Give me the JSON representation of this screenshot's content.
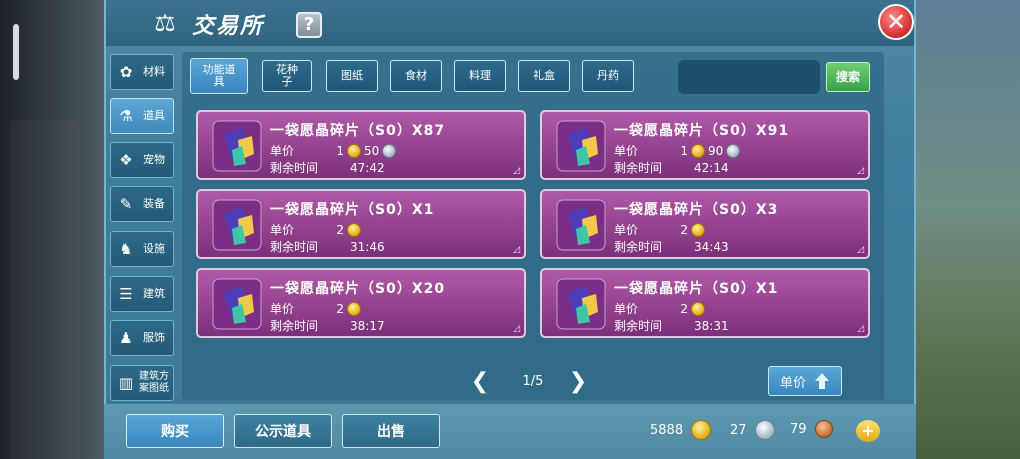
{
  "window": {
    "title": "交易所",
    "help_label": "?",
    "close_label": "✕"
  },
  "sidebar": {
    "items": [
      {
        "label": "材料",
        "icon": "materials-icon",
        "active": false
      },
      {
        "label": "道具",
        "icon": "flask-icon",
        "active": true
      },
      {
        "label": "宠物",
        "icon": "paw-icon",
        "active": false
      },
      {
        "label": "装备",
        "icon": "sword-icon",
        "active": false
      },
      {
        "label": "设施",
        "icon": "horse-icon",
        "active": false
      },
      {
        "label": "建筑",
        "icon": "building-icon",
        "active": false
      },
      {
        "label": "服饰",
        "icon": "clothing-icon",
        "active": false
      },
      {
        "label": "建筑方案图纸",
        "icon": "blueprint-icon",
        "active": false
      }
    ]
  },
  "tabs": [
    {
      "label": "功能道具",
      "active": true
    },
    {
      "label": "花种子",
      "active": false
    },
    {
      "label": "图纸",
      "active": false
    },
    {
      "label": "食材",
      "active": false
    },
    {
      "label": "料理",
      "active": false
    },
    {
      "label": "礼盒",
      "active": false
    },
    {
      "label": "丹药",
      "active": false
    }
  ],
  "search": {
    "placeholder": "",
    "button_label": "搜索"
  },
  "listing_labels": {
    "unit_price": "单价",
    "time_left": "剩余时间"
  },
  "listings": [
    {
      "name": "一袋愿晶碎片（S0）X87",
      "gold": "1",
      "silver": "50",
      "time_left": "47:42"
    },
    {
      "name": "一袋愿晶碎片（S0）X91",
      "gold": "1",
      "silver": "90",
      "time_left": "42:14"
    },
    {
      "name": "一袋愿晶碎片（S0）X1",
      "gold": "2",
      "silver": "",
      "time_left": "31:46"
    },
    {
      "name": "一袋愿晶碎片（S0）X3",
      "gold": "2",
      "silver": "",
      "time_left": "34:43"
    },
    {
      "name": "一袋愿晶碎片（S0）X20",
      "gold": "2",
      "silver": "",
      "time_left": "38:17"
    },
    {
      "name": "一袋愿晶碎片（S0）X1",
      "gold": "2",
      "silver": "",
      "time_left": "38:31"
    }
  ],
  "pager": {
    "text": "1/5",
    "prev": "❮",
    "next": "❯"
  },
  "sort": {
    "label": "单价"
  },
  "footer": {
    "buy_label": "购买",
    "public_label": "公示道具",
    "sell_label": "出售",
    "gold": "5888",
    "silver": "27",
    "copper": "79",
    "plus_label": "+"
  },
  "colors": {
    "card_top": "#b05aa6",
    "card_bottom": "#7c2f7a",
    "accent_blue": "#3b86bf",
    "search_green": "#3aa04a",
    "close_red": "#d12b2b"
  }
}
